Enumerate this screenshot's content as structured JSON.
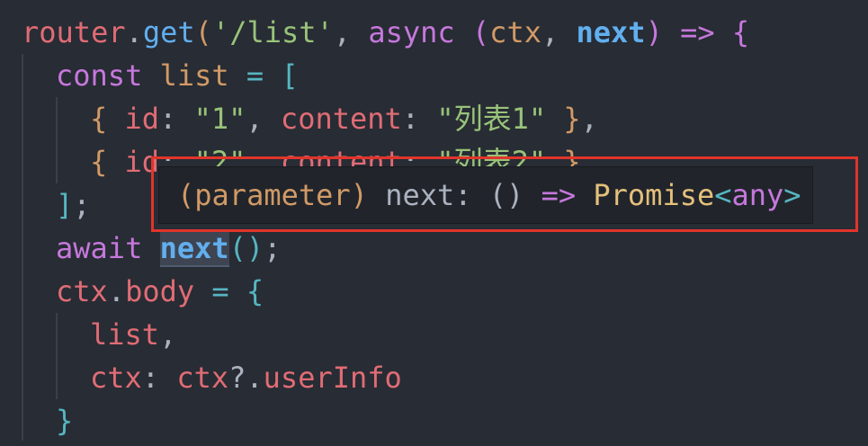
{
  "code": {
    "line1": {
      "router": "router",
      "dot": ".",
      "get": "get",
      "open_paren": "(",
      "path": "'/list'",
      "comma": ", ",
      "async": "async",
      "params_open": " (",
      "ctx": "ctx",
      "sep": ", ",
      "next": "next",
      "params_close": ")",
      "arrow": " => ",
      "brace": "{"
    },
    "line2": {
      "const": "const",
      "name": " list",
      "eq": " = ",
      "bracket": "["
    },
    "line3": {
      "brace_open": "{",
      "id_key": " id",
      "colon1": ": ",
      "id_val": "\"1\"",
      "comma": ", ",
      "content_key": "content",
      "colon2": ": ",
      "content_val": "\"列表1\"",
      "brace_close": " }",
      "trail": ","
    },
    "line4": {
      "brace_open": "{",
      "id_key": " id",
      "colon1": ": ",
      "id_val": "\"2\"",
      "comma": ", ",
      "content_key": "content",
      "colon2": ": ",
      "content_val": "\"列表2\"",
      "brace_close": " }"
    },
    "line5": {
      "bracket": "]",
      "semi": ";"
    },
    "line6": {
      "await": "await",
      "space": " ",
      "next": "next",
      "parens": "()",
      "semi": ";"
    },
    "line7": {
      "ctx": "ctx",
      "dot": ".",
      "body": "body",
      "eq": " = ",
      "brace": "{"
    },
    "line8": {
      "list": "list",
      "comma": ","
    },
    "line9": {
      "key": "ctx",
      "colon": ": ",
      "obj": "ctx",
      "opt": "?.",
      "prop": "userInfo"
    },
    "line10": {
      "brace": "}"
    }
  },
  "hover": {
    "kind": "(parameter)",
    "name": " next: ",
    "signature_parens": "()",
    "arrow": " => ",
    "type": "Promise",
    "lt": "<",
    "any": "any",
    "gt": ">"
  },
  "colors": {
    "background": "#282c34",
    "annotation_border": "#e0352b"
  }
}
